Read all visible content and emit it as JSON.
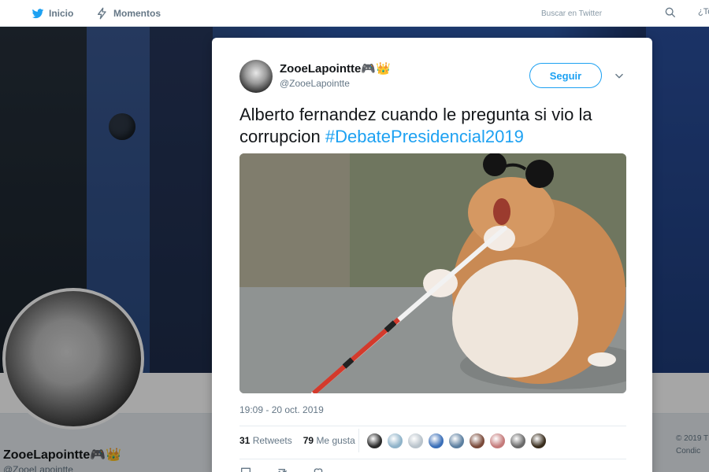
{
  "nav": {
    "home_label": "Inicio",
    "moments_label": "Momentos",
    "search_placeholder": "Buscar en Twitter",
    "trail": "¿To"
  },
  "profile": {
    "name": "ZooeLapointte🎮👑",
    "handle": "@ZooeLapointte",
    "footer_line1": "© 2019 T",
    "footer_line2": "Condic"
  },
  "tweet": {
    "author_name": "ZooeLapointte🎮👑",
    "author_handle": "@ZooeLapointte",
    "follow_label": "Seguir",
    "text": "Alberto fernandez cuando le pregunta si vio la corrupcion ",
    "hashtag": "#DebatePresidencial2019",
    "timestamp": "19:09 - 20 oct. 2019",
    "retweets_count": "31",
    "retweets_label": "Retweets",
    "likes_count": "79",
    "likes_label": "Me gusta",
    "liker_colors": [
      "#2b2b2b",
      "#8fb3c9",
      "#b9c3cb",
      "#3b6fb8",
      "#5c7fa0",
      "#7a4a3a",
      "#c47a7a",
      "#6a6a6a",
      "#3a2e1e"
    ]
  },
  "colors": {
    "accent": "#1da1f2"
  }
}
